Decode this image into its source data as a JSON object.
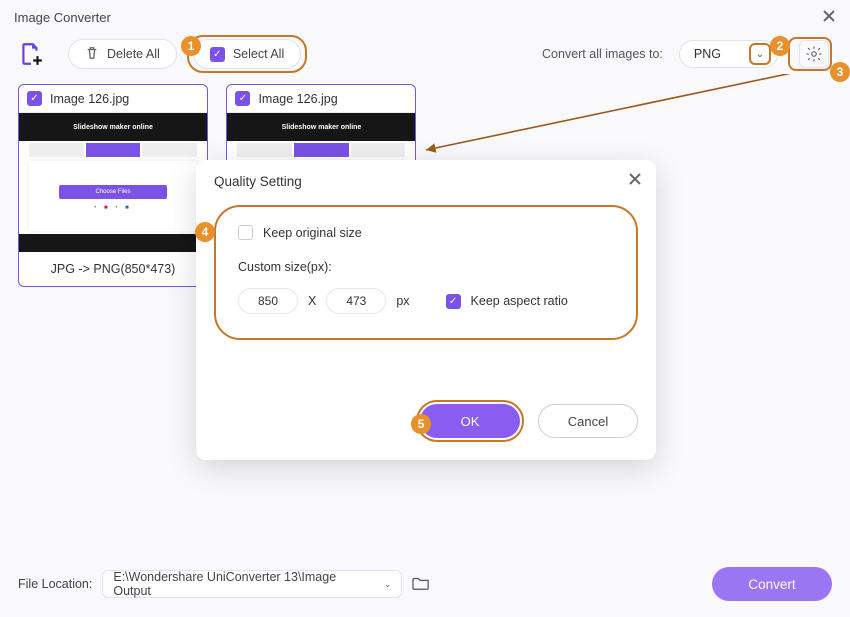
{
  "window": {
    "title": "Image Converter"
  },
  "toolbar": {
    "delete_all": "Delete All",
    "select_all": "Select All",
    "convert_to_label": "Convert all images to:",
    "format": "PNG"
  },
  "cards": [
    {
      "checked": true,
      "name": "Image 126.jpg",
      "thumb_title": "Slideshow maker online",
      "footer": "JPG -> PNG(850*473)"
    },
    {
      "checked": true,
      "name": "Image 126.jpg",
      "thumb_title": "Slideshow maker online",
      "footer": ""
    }
  ],
  "modal": {
    "title": "Quality Setting",
    "keep_original": "Keep original size",
    "custom_label": "Custom size(px):",
    "width": "850",
    "x_sep": "X",
    "height": "473",
    "px": "px",
    "keep_ratio": "Keep aspect ratio",
    "ok": "OK",
    "cancel": "Cancel"
  },
  "footer": {
    "file_location_label": "File Location:",
    "path": "E:\\Wondershare UniConverter 13\\Image Output",
    "convert": "Convert"
  },
  "badges": {
    "b1": "1",
    "b2": "2",
    "b3": "3",
    "b4": "4",
    "b5": "5"
  }
}
